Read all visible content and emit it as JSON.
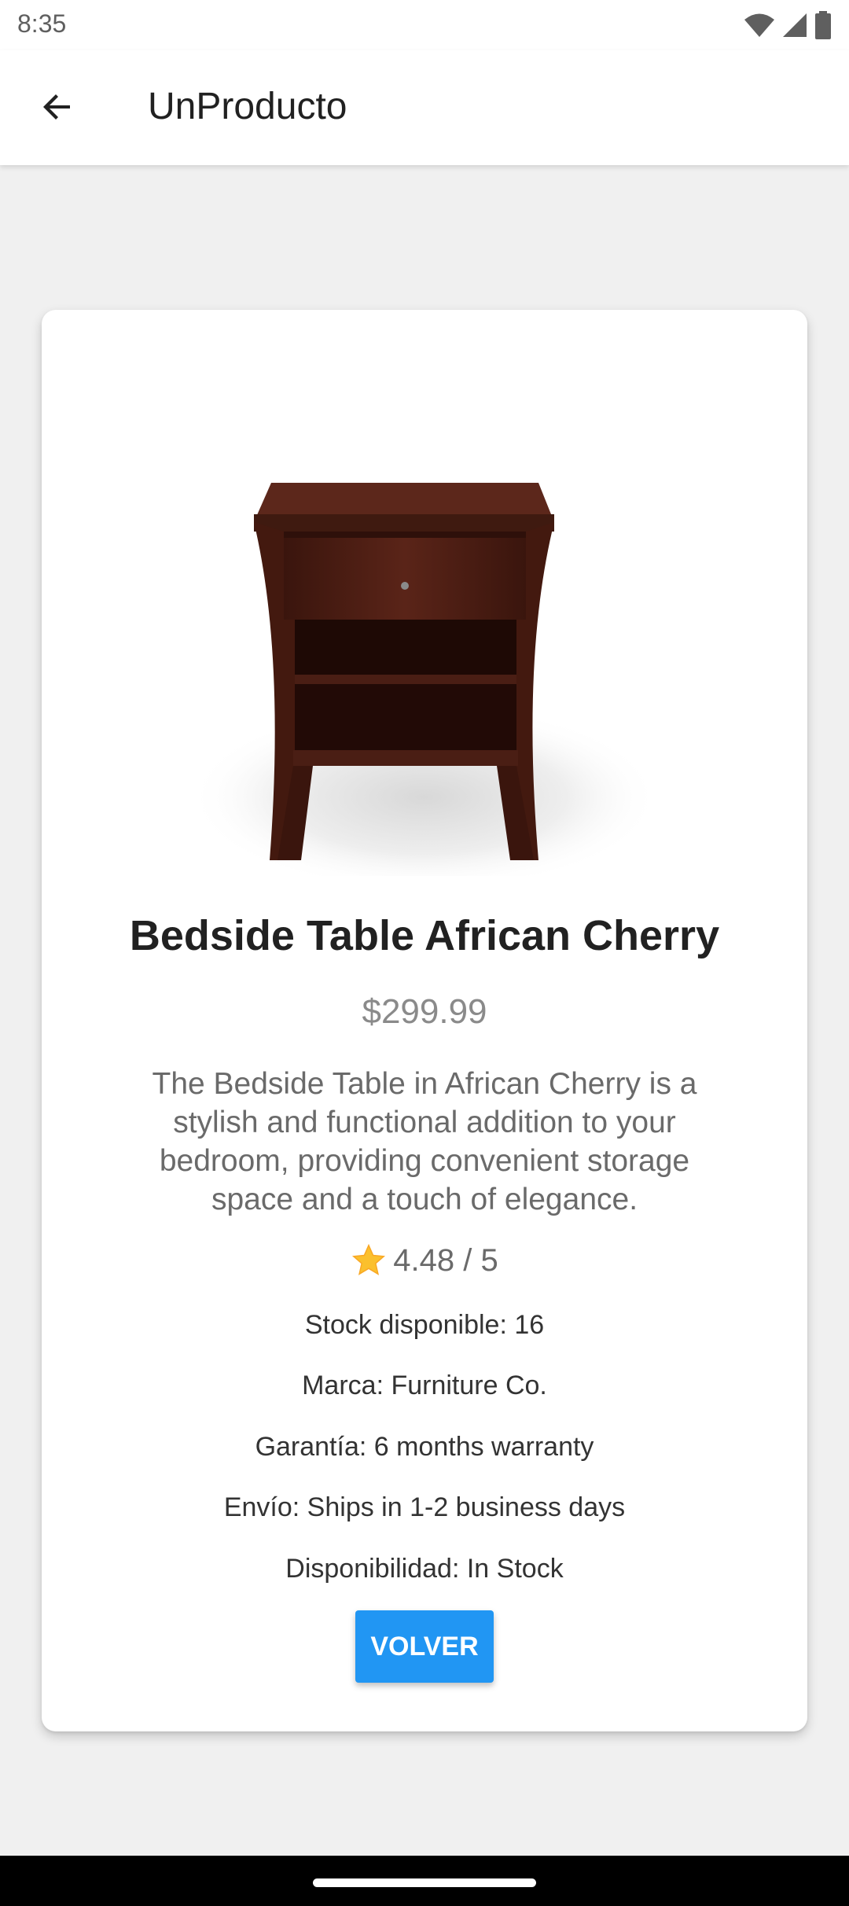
{
  "status_bar": {
    "time": "8:35",
    "icons": [
      "wifi-icon",
      "signal-icon",
      "battery-icon"
    ]
  },
  "app_bar": {
    "back_icon": "arrow-back-icon",
    "title": "UnProducto"
  },
  "product": {
    "image_alt": "bedside-table-image",
    "name": "Bedside Table African Cherry",
    "price": "$299.99",
    "description": "The Bedside Table in African Cherry is a stylish and functional addition to your bedroom, providing convenient storage space and a touch of elegance.",
    "rating_icon": "star-icon",
    "rating_text": "4.48 / 5",
    "stock": "Stock disponible: 16",
    "brand": "Marca: Furniture Co.",
    "warranty": "Garantía: 6 months warranty",
    "shipping": "Envío: Ships in 1-2 business days",
    "availability": "Disponibilidad: In Stock"
  },
  "actions": {
    "back_button_label": "VOLVER"
  },
  "colors": {
    "primary": "#2196f3",
    "background": "#f0f0f0",
    "card": "#ffffff",
    "wood": "#4a1e14"
  }
}
